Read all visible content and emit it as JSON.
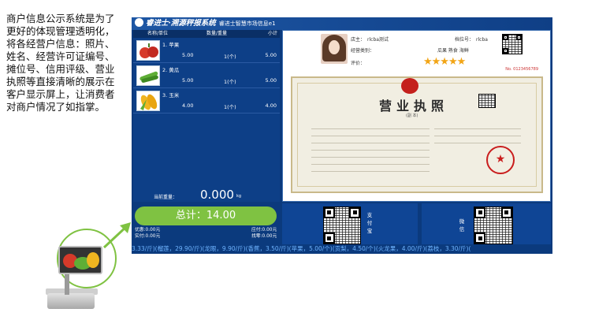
{
  "description": "商户信息公示系统是为了更好的体现管理透明化，将各经营户信息：照片、姓名、经营许可证编号、摊位号、信用评级、营业执照等直接清晰的展示在客户显示屏上，让消费者对商户情况了如指掌。",
  "app": {
    "brand": "睿进士·溯源秤报系统",
    "subtitle": "睿进士智慧市场信息e1"
  },
  "product_list": {
    "columns": [
      "名称/单位",
      "数量/重量",
      "小计"
    ],
    "items": [
      {
        "name": "1. 苹果",
        "price": "5.00",
        "qty": "1(个)",
        "subtotal": "5.00",
        "thumb_color": "#d63a2a"
      },
      {
        "name": "2. 黄瓜",
        "price": "5.00",
        "qty": "1(个)",
        "subtotal": "5.00",
        "thumb_color": "#5fae36"
      },
      {
        "name": "3. 玉米",
        "price": "4.00",
        "qty": "1(个)",
        "subtotal": "4.00",
        "thumb_color": "#f0b520"
      }
    ]
  },
  "weight": {
    "label": "当前重量：",
    "value": "0.000",
    "unit": "kg"
  },
  "merchant": {
    "shop_label": "店主：",
    "shop_value": "rlcba测试",
    "stall_label": "档位号：",
    "stall_value": "rlcba",
    "category_label": "经营类别：",
    "category_value": "瓜果 熟食 海鲜",
    "rating_label": "评价：",
    "rating_stars": "★★★★★"
  },
  "license": {
    "title": "营业执照",
    "copy": "(副 本)",
    "serial": "No. 0123456789",
    "seal": "★"
  },
  "totals": {
    "total_label": "总计：",
    "total_value": "14.00",
    "discount": "优惠:0.00元",
    "payable": "应付:0.00元",
    "paid": "实付:0.00元",
    "change": "找零:0.00元"
  },
  "payment": {
    "alipay": "支付宝",
    "wechat": "微信"
  },
  "ticker": "3.33/斤)(榴莲，29.90/斤)(龙眼，9.90/斤)(香蕉，3.50/斤)(苹果，5.00/个)(贡梨，4.50/个)(火龙果，4.00/斤)(荔枝，3.30/斤)("
}
